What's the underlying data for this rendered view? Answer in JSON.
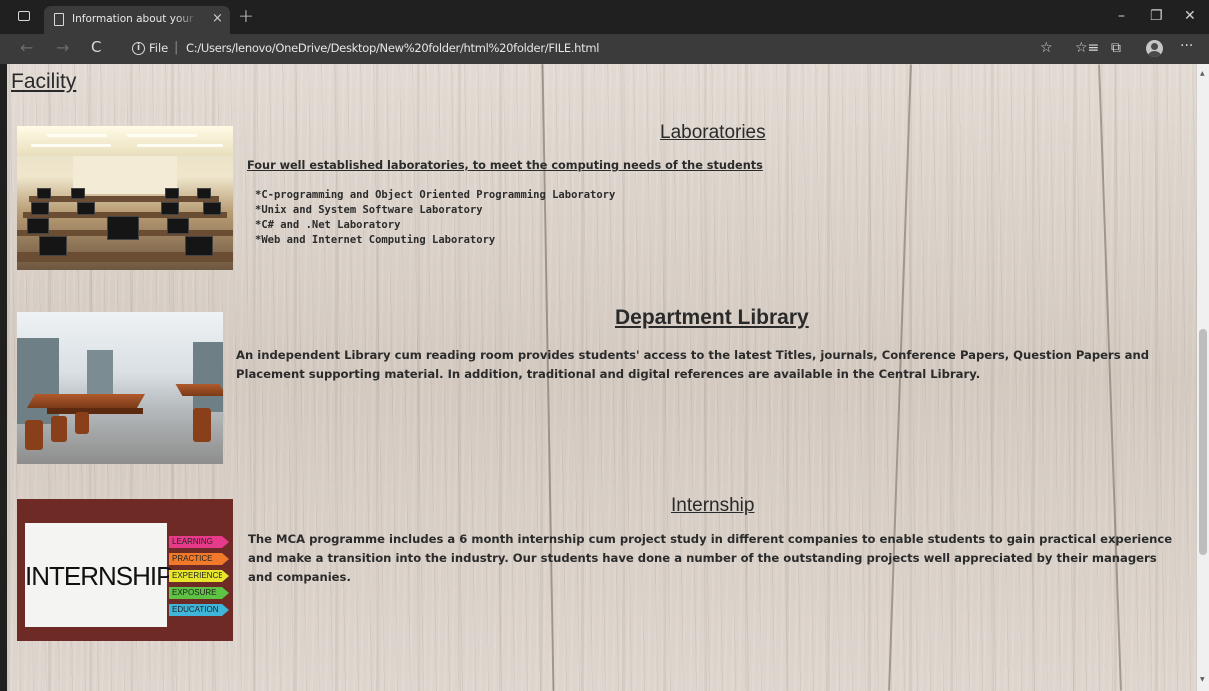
{
  "browser": {
    "tab_title": "Information about your departm",
    "tab_close": "×",
    "new_tab": "+",
    "back": "←",
    "forward": "→",
    "reload": "C",
    "info": "i",
    "scheme": "File",
    "separator": "|",
    "url": "C:/Users/lenovo/OneDrive/Desktop/New%20folder/html%20folder/FILE.html",
    "minimize": "–",
    "restore": "❐",
    "close": "✕",
    "favorites_add": "☆",
    "favorites": "☆≡",
    "collections": "⧉",
    "more": "···"
  },
  "page": {
    "title": "Facility",
    "labs": {
      "heading": "Laboratories",
      "subheading": "Four well established laboratories, to meet the computing needs of the students",
      "items": [
        "*C-programming and Object Oriented Programming Laboratory",
        "*Unix and System Software Laboratory",
        "*C# and .Net Laboratory",
        "*Web and Internet Computing Laboratory"
      ]
    },
    "library": {
      "heading": "Department Library",
      "body": "An independent Library cum reading room provides students' access to the latest Titles, journals, Conference Papers, Question Papers and Placement supporting material. In addition, traditional and digital references are available in the Central Library."
    },
    "internship": {
      "heading": "Internship",
      "body": "The MCA programme includes a 6 month internship cum project study in different companies to enable students to gain practical experience and make a transition into the industry. Our students have done a number of the outstanding projects well appreciated by their managers and companies.",
      "image_word": "INTERNSHIP",
      "image_tags": [
        "LEARNING",
        "PRACTICE",
        "EXPERIENCE",
        "EXPOSURE",
        "EDUCATION"
      ]
    }
  },
  "colors": {
    "tag_learning": "#e83a8a",
    "tag_practice": "#f07a2a",
    "tag_experience": "#e7e62c",
    "tag_exposure": "#5ec245",
    "tag_education": "#3fb6d9"
  }
}
